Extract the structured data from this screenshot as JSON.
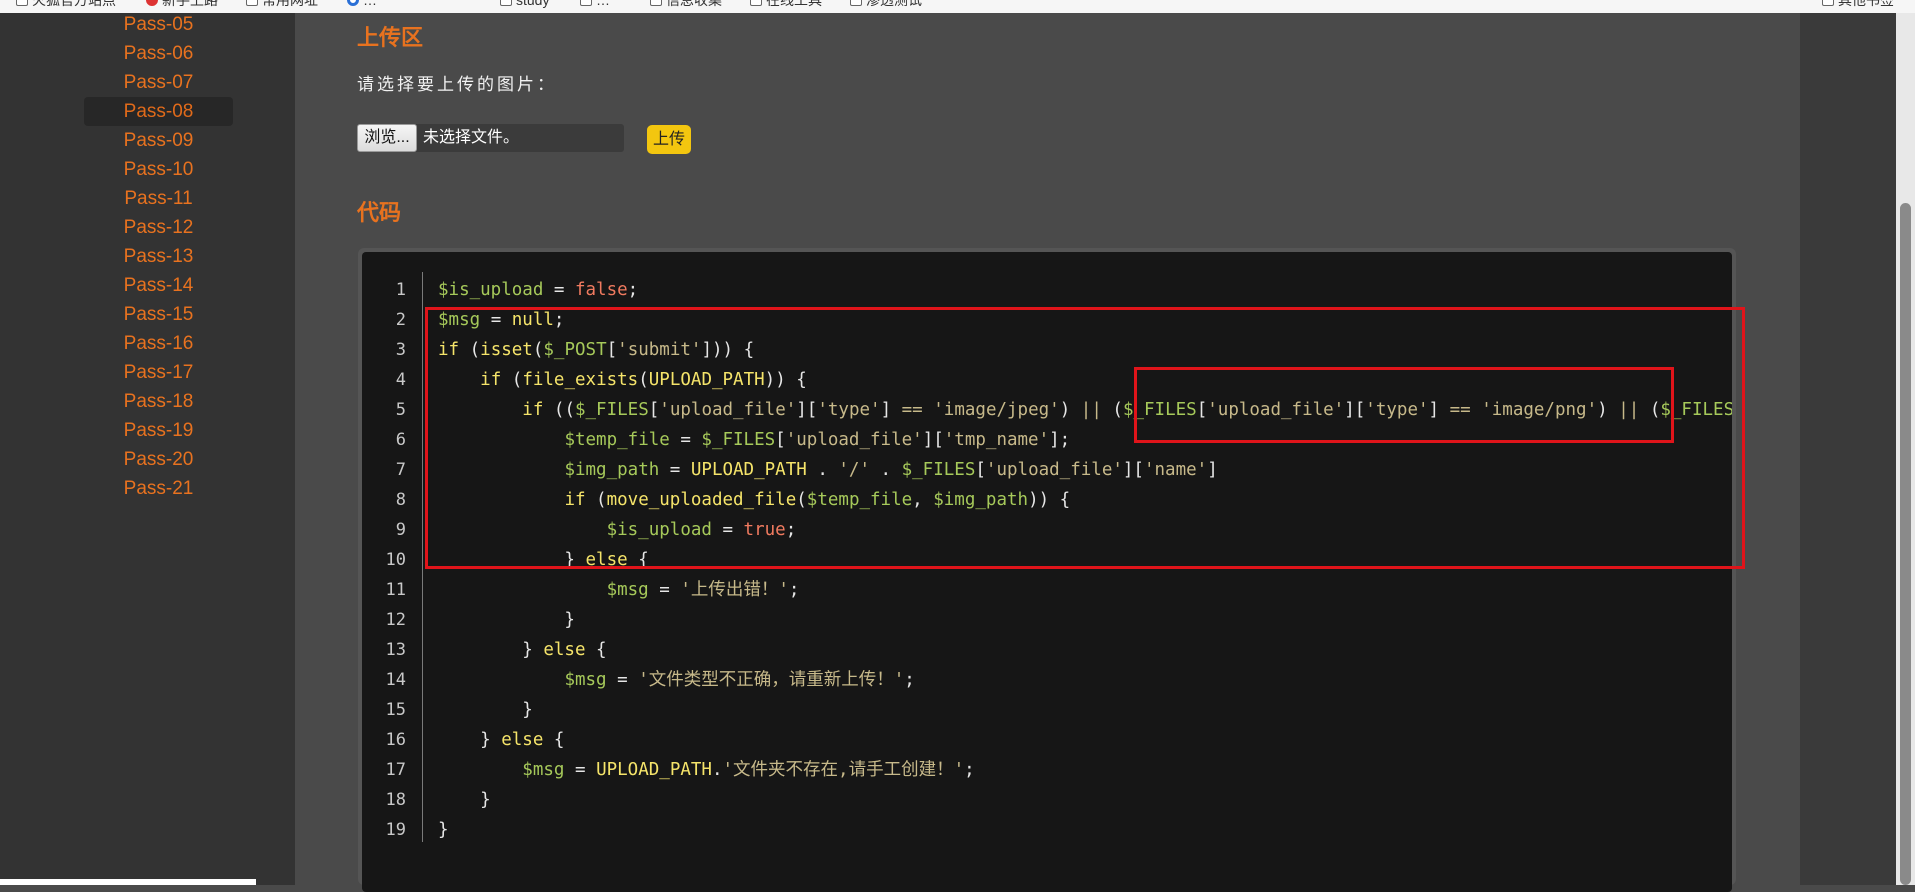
{
  "bookmarks": [
    {
      "label": "火狐官方站点",
      "icon": "folder-icon"
    },
    {
      "label": "新手上路",
      "icon": "firefox-icon"
    },
    {
      "label": "常用网址",
      "icon": "folder-icon"
    },
    {
      "label": "…",
      "icon": "globe-icon"
    },
    {
      "label": "study",
      "icon": "folder-icon"
    },
    {
      "label": "…",
      "icon": "folder-icon"
    },
    {
      "label": "信息收集",
      "icon": "folder-icon"
    },
    {
      "label": "在线工具",
      "icon": "folder-icon"
    },
    {
      "label": "渗透测试",
      "icon": "folder-icon"
    },
    {
      "label": "其他书签",
      "icon": "folder-icon"
    }
  ],
  "sidebar": {
    "items": [
      "Pass-05",
      "Pass-06",
      "Pass-07",
      "Pass-08",
      "Pass-09",
      "Pass-10",
      "Pass-11",
      "Pass-12",
      "Pass-13",
      "Pass-14",
      "Pass-15",
      "Pass-16",
      "Pass-17",
      "Pass-18",
      "Pass-19",
      "Pass-20",
      "Pass-21"
    ],
    "active": "Pass-08"
  },
  "upload": {
    "title": "上传区",
    "prompt": "请选择要上传的图片：",
    "browse_label": "浏览...",
    "file_status": "未选择文件。",
    "submit_label": "上传"
  },
  "code_section": {
    "title": "代码",
    "line_numbers": [
      "1",
      "2",
      "3",
      "4",
      "5",
      "6",
      "7",
      "8",
      "9",
      "10",
      "11",
      "12",
      "13",
      "14",
      "15",
      "16",
      "17",
      "18",
      "19"
    ]
  },
  "colors": {
    "accent": "#e8721f",
    "highlight": "#e0141a",
    "upload_button": "#f3c60f"
  }
}
